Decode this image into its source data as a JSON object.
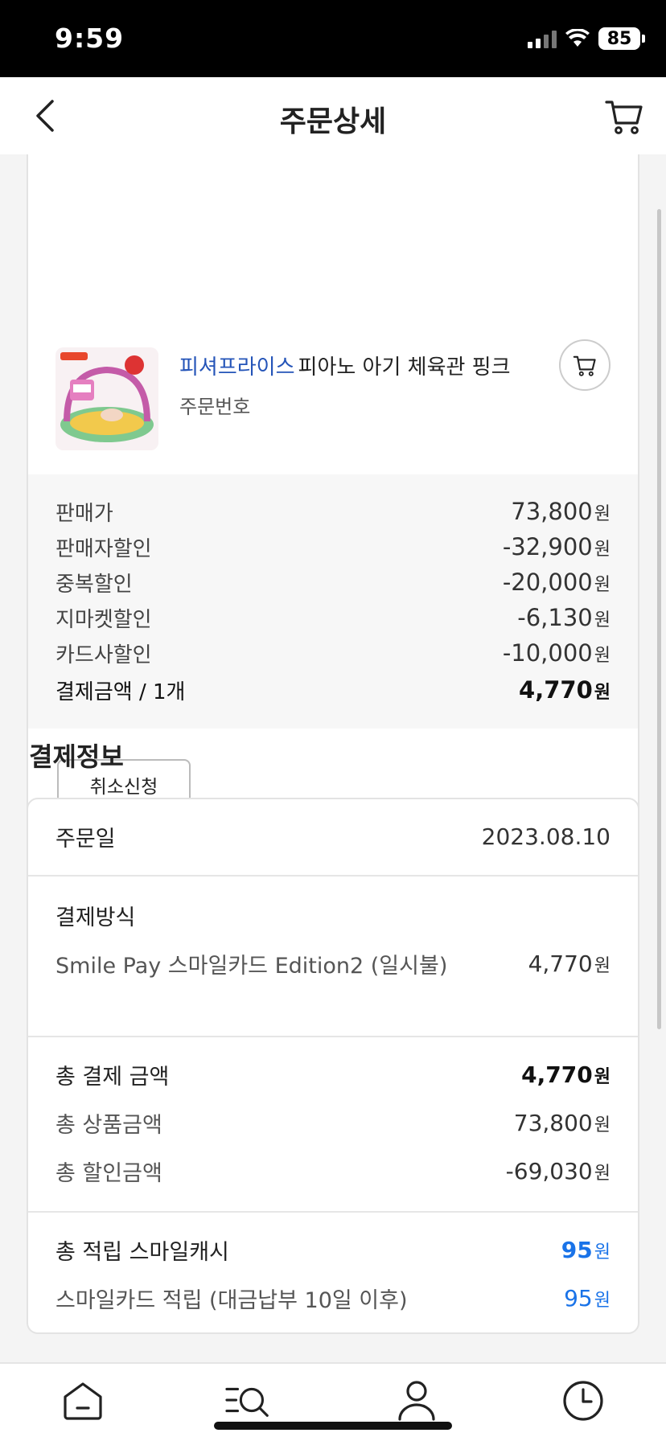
{
  "status_bar": {
    "time": "9:59",
    "battery": "85"
  },
  "header": {
    "title": "주문상세"
  },
  "order_item": {
    "brand": "피셔프라이스",
    "product_name": "피아노 아기 체육관 핑크",
    "order_number_label": "주문번호"
  },
  "prices": [
    {
      "label": "판매가",
      "amount": "73,800",
      "unit": "원"
    },
    {
      "label": "판매자할인",
      "amount": "-32,900",
      "unit": "원"
    },
    {
      "label": "중복할인",
      "amount": "-20,000",
      "unit": "원"
    },
    {
      "label": "지마켓할인",
      "amount": "-6,130",
      "unit": "원"
    },
    {
      "label": "카드사할인",
      "amount": "-10,000",
      "unit": "원"
    },
    {
      "label": "결제금액 / 1개",
      "amount": "4,770",
      "unit": "원"
    }
  ],
  "cancel_button": "취소신청",
  "payment_info": {
    "title": "결제정보",
    "order_date_label": "주문일",
    "order_date": "2023.08.10",
    "method_label": "결제방식",
    "method": "Smile Pay 스마일카드 Edition2 (일시불)",
    "method_amount": "4,770",
    "total_label": "총 결제 금액",
    "total_amount": "4,770",
    "product_total_label": "총 상품금액",
    "product_total": "73,800",
    "discount_total_label": "총 할인금액",
    "discount_total": "-69,030",
    "smilecash_label": "총 적립 스마일캐시",
    "smilecash": "95",
    "card_reward_label": "스마일카드 적립 (대금납부 10일 이후)",
    "card_reward": "95",
    "unit": "원"
  },
  "icons": {
    "back": "chevron-left-icon",
    "cart": "cart-icon",
    "nav": [
      "home-icon",
      "category-search-icon",
      "my-page-icon",
      "recent-history-icon"
    ]
  },
  "colors": {
    "link_blue": "#2454b8",
    "accent_blue": "#1a73e8"
  }
}
